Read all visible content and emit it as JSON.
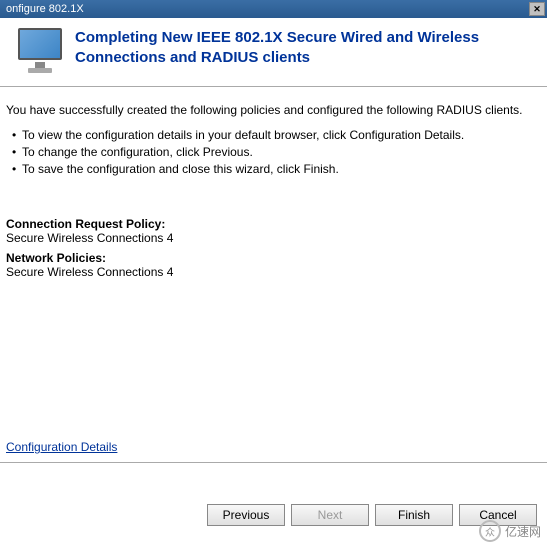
{
  "titlebar": {
    "text": "onfigure 802.1X"
  },
  "header": {
    "title": "Completing New IEEE 802.1X Secure Wired and Wireless Connections and RADIUS clients"
  },
  "body": {
    "intro": "You have successfully created the following policies and configured the following RADIUS clients.",
    "bullets": [
      "To view the configuration details in your default browser, click Configuration Details.",
      "To change the configuration, click Previous.",
      "To save the configuration and close this wizard, click Finish."
    ],
    "connection_request_label": "Connection Request Policy:",
    "connection_request_value": "Secure Wireless Connections 4",
    "network_policies_label": "Network Policies:",
    "network_policies_value": "Secure Wireless Connections 4",
    "config_link": "Configuration Details"
  },
  "buttons": {
    "previous": "Previous",
    "next": "Next",
    "finish": "Finish",
    "cancel": "Cancel"
  },
  "watermark": {
    "text": "亿速网"
  }
}
